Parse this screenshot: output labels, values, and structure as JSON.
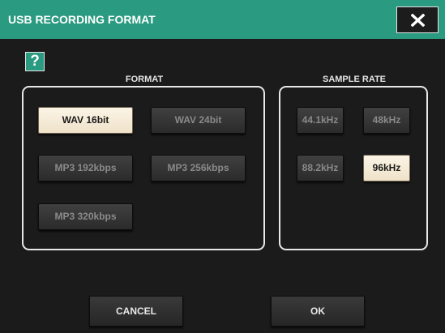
{
  "dialog": {
    "title": "USB RECORDING FORMAT",
    "help_label": "?"
  },
  "format": {
    "label": "FORMAT",
    "options": [
      "WAV 16bit",
      "WAV 24bit",
      "MP3 192kbps",
      "MP3 256kbps",
      "MP3 320kbps"
    ],
    "selected": "WAV 16bit"
  },
  "sample_rate": {
    "label": "SAMPLE RATE",
    "options": [
      "44.1kHz",
      "48kHz",
      "88.2kHz",
      "96kHz"
    ],
    "selected": "96kHz"
  },
  "actions": {
    "cancel_label": "CANCEL",
    "ok_label": "OK"
  },
  "colors": {
    "accent": "#2a9a80",
    "background": "#1b1b1b",
    "selected_button": "#f5ecd9"
  },
  "icons": {
    "close": "close-icon",
    "help": "help-icon"
  }
}
